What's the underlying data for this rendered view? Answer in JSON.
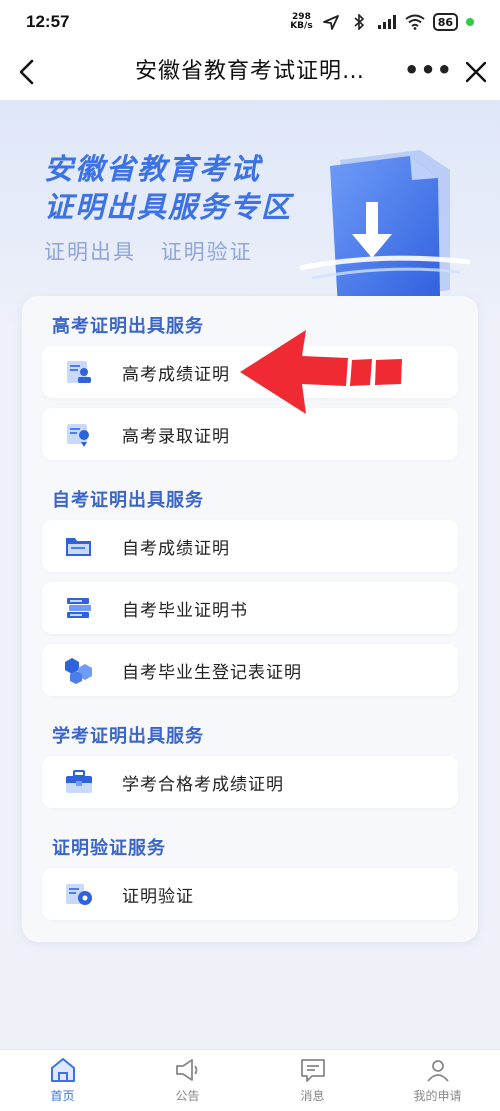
{
  "status_bar": {
    "time": "12:57",
    "net_speed_value": "298",
    "net_speed_unit": "KB/s",
    "battery": "86"
  },
  "nav": {
    "title": "安徽省教育考试证明…",
    "more": "•••"
  },
  "hero": {
    "title_line1": "安徽省教育考试",
    "title_line2": "证明出具服务专区",
    "sub1": "证明出具",
    "sub2": "证明验证"
  },
  "sections": [
    {
      "title": "高考证明出具服务",
      "items": [
        {
          "label": "高考成绩证明",
          "icon": "score-doc-icon"
        },
        {
          "label": "高考录取证明",
          "icon": "admission-doc-icon"
        }
      ]
    },
    {
      "title": "自考证明出具服务",
      "items": [
        {
          "label": "自考成绩证明",
          "icon": "folder-icon"
        },
        {
          "label": "自考毕业证明书",
          "icon": "books-icon"
        },
        {
          "label": "自考毕业生登记表证明",
          "icon": "cubes-icon"
        }
      ]
    },
    {
      "title": "学考证明出具服务",
      "items": [
        {
          "label": "学考合格考成绩证明",
          "icon": "briefcase-icon"
        }
      ]
    },
    {
      "title": "证明验证服务",
      "items": [
        {
          "label": "证明验证",
          "icon": "verify-gear-icon"
        }
      ]
    }
  ],
  "tabs": [
    {
      "label": "首页",
      "icon": "home-icon",
      "active": true
    },
    {
      "label": "公告",
      "icon": "megaphone-icon",
      "active": false
    },
    {
      "label": "消息",
      "icon": "message-icon",
      "active": false
    },
    {
      "label": "我的申请",
      "icon": "user-icon",
      "active": false
    }
  ],
  "colors": {
    "accent": "#3c72e3",
    "section_title": "#3c66c6",
    "annotation_arrow": "#ef2a33"
  }
}
